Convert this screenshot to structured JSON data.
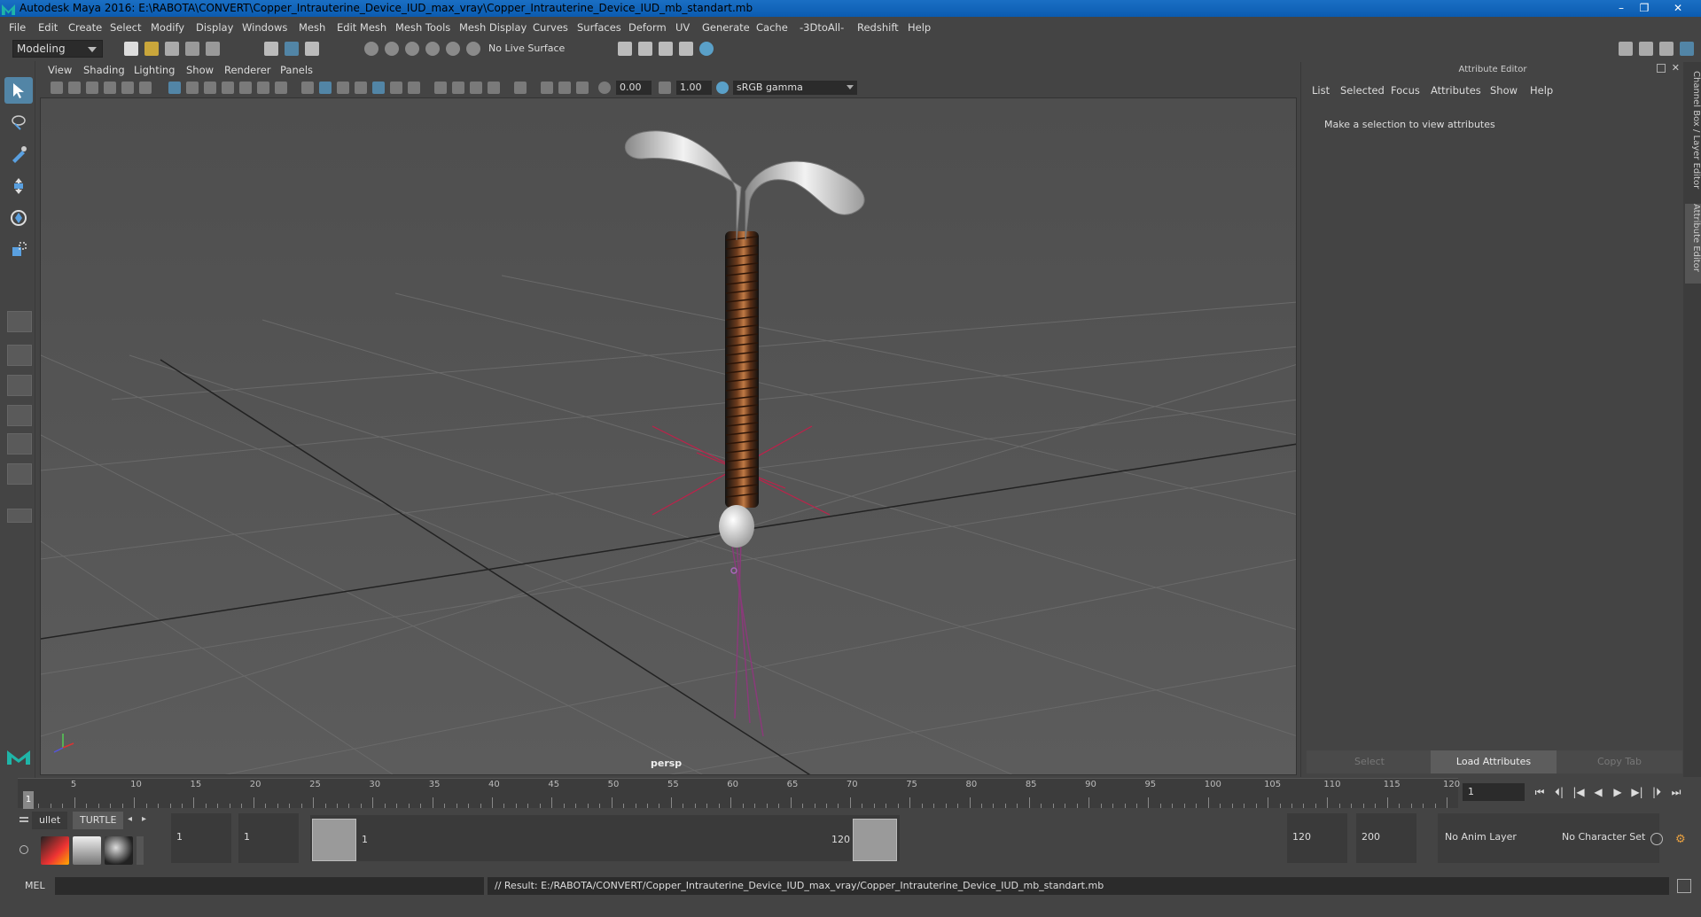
{
  "window": {
    "title": "Autodesk Maya 2016: E:\\RABOTA\\CONVERT\\Copper_Intrauterine_Device_IUD_max_vray\\Copper_Intrauterine_Device_IUD_mb_standart.mb",
    "minimize": "–",
    "restore": "❐",
    "close": "✕"
  },
  "menubar": [
    "File",
    "Edit",
    "Create",
    "Select",
    "Modify",
    "Display",
    "Windows",
    "Mesh",
    "Edit Mesh",
    "Mesh Tools",
    "Mesh Display",
    "Curves",
    "Surfaces",
    "Deform",
    "UV",
    "Generate",
    "Cache",
    "-3DtoAll-",
    "Redshift",
    "Help"
  ],
  "statusline": {
    "mode": "Modeling",
    "live_surface": "No Live Surface"
  },
  "viewport": {
    "menu": [
      "View",
      "Shading",
      "Lighting",
      "Show",
      "Renderer",
      "Panels"
    ],
    "exposure": "0.00",
    "gamma": "1.00",
    "colorspace": "sRGB gamma",
    "camera_label": "persp"
  },
  "attribute_editor": {
    "title": "Attribute Editor",
    "menu": [
      "List",
      "Selected",
      "Focus",
      "Attributes",
      "Show",
      "Help"
    ],
    "message": "Make a selection to view attributes",
    "buttons": {
      "select": "Select",
      "load": "Load Attributes",
      "copy": "Copy Tab"
    },
    "side_tabs": [
      "Channel Box / Layer Editor",
      "Attribute Editor"
    ]
  },
  "timeline": {
    "current_frame": "1",
    "ticks": [
      "5",
      "10",
      "15",
      "20",
      "25",
      "30",
      "35",
      "40",
      "45",
      "50",
      "55",
      "60",
      "65",
      "70",
      "75",
      "80",
      "85",
      "90",
      "95",
      "100",
      "105",
      "110",
      "115",
      "120"
    ],
    "frame_field": "1",
    "play_buttons": [
      "⏮",
      "⏴|",
      "|◀",
      "◀",
      "▶",
      "▶|",
      "|⏵",
      "⏭"
    ]
  },
  "range": {
    "shelf_tabs": [
      "ullet",
      "TURTLE"
    ],
    "start": "1",
    "start2": "1",
    "range_start": "1",
    "range_end": "120",
    "end": "120",
    "end2": "200",
    "anim_layer": "No Anim Layer",
    "char_set": "No Character Set"
  },
  "cmdline": {
    "lang": "MEL",
    "result": "// Result: E:/RABOTA/CONVERT/Copper_Intrauterine_Device_IUD_max_vray/Copper_Intrauterine_Device_IUD_mb_standart.mb"
  },
  "colors": {
    "accent": "#5285a6",
    "titlebar": "#0b5bb0",
    "copper": "#b06a3a",
    "pivot": "#c0204a"
  }
}
